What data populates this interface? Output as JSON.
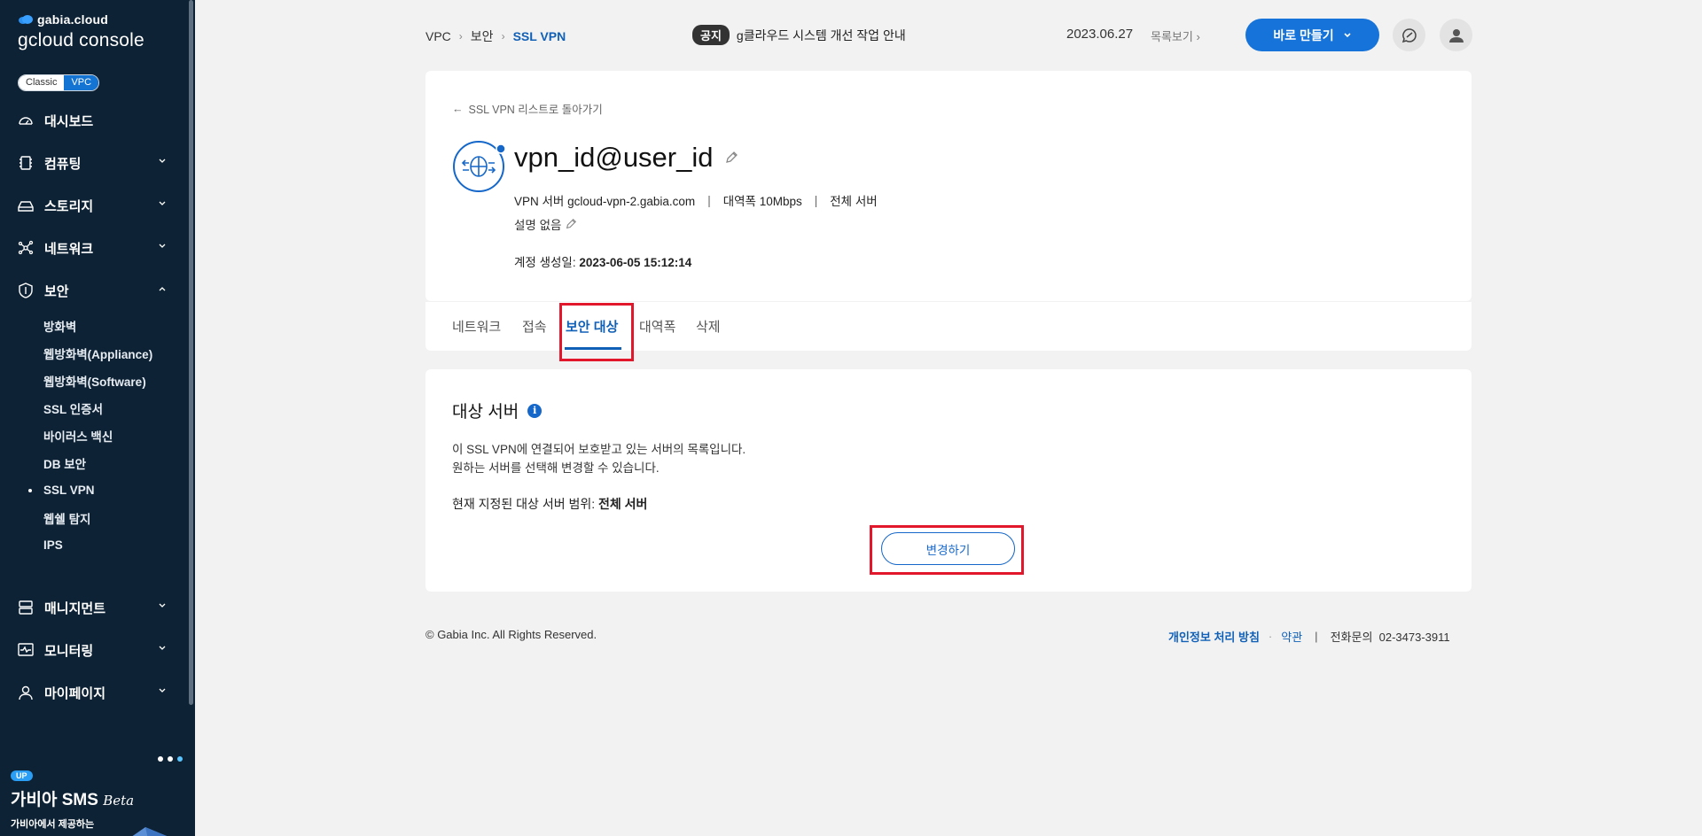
{
  "sidebar": {
    "brand_top": "gabia.cloud",
    "brand_name": "gcloud console",
    "mode": {
      "classic": "Classic",
      "vpc": "VPC"
    },
    "items": [
      {
        "label": "대시보드",
        "icon": "dashboard-icon"
      },
      {
        "label": "컴퓨팅",
        "icon": "chip-icon"
      },
      {
        "label": "스토리지",
        "icon": "storage-icon"
      },
      {
        "label": "네트워크",
        "icon": "network-icon"
      },
      {
        "label": "보안",
        "icon": "shield-icon"
      },
      {
        "label": "매니지먼트",
        "icon": "management-icon"
      },
      {
        "label": "모니터링",
        "icon": "monitoring-icon"
      },
      {
        "label": "마이페이지",
        "icon": "user-icon"
      }
    ],
    "security_sub": [
      "방화벽",
      "웹방화벽(Appliance)",
      "웹방화벽(Software)",
      "SSL 인증서",
      "바이러스 백신",
      "DB 보안",
      "SSL VPN",
      "웹쉘 탐지",
      "IPS"
    ],
    "promo": {
      "badge": "UP",
      "title": "가비아 SMS",
      "title_em": "Beta",
      "sub": "가비아에서 제공하는"
    }
  },
  "topbar": {
    "breadcrumb": [
      "VPC",
      "보안",
      "SSL VPN"
    ],
    "notice_badge": "공지",
    "notice_text": "g클라우드 시스템 개선 작업 안내",
    "notice_date": "2023.06.27",
    "notice_more": "목록보기",
    "create_label": "바로 만들기"
  },
  "detail": {
    "back_label": "SSL VPN 리스트로 돌아가기",
    "title": "vpn_id@user_id",
    "server": "VPN 서버 gcloud-vpn-2.gabia.com",
    "bandwidth": "대역폭 10Mbps",
    "scope": "전체 서버",
    "description": "설명 없음",
    "created_label": "계정 생성일:",
    "created_value": "2023-06-05 15:12:14"
  },
  "tabs": [
    "네트워크",
    "접속",
    "보안 대상",
    "대역폭",
    "삭제"
  ],
  "target": {
    "title": "대상 서버",
    "desc_line1": "이 SSL VPN에 연결되어 보호받고 있는 서버의 목록입니다.",
    "desc_line2": "원하는 서버를 선택해 변경할 수 있습니다.",
    "range_label": "현재 지정된 대상 서버 범위:",
    "range_value": "전체 서버",
    "change_label": "변경하기"
  },
  "footer": {
    "copyright": "© Gabia Inc. All Rights Reserved.",
    "privacy": "개인정보 처리 방침",
    "terms": "약관",
    "phone": "전화문의  02-3473-3911"
  }
}
